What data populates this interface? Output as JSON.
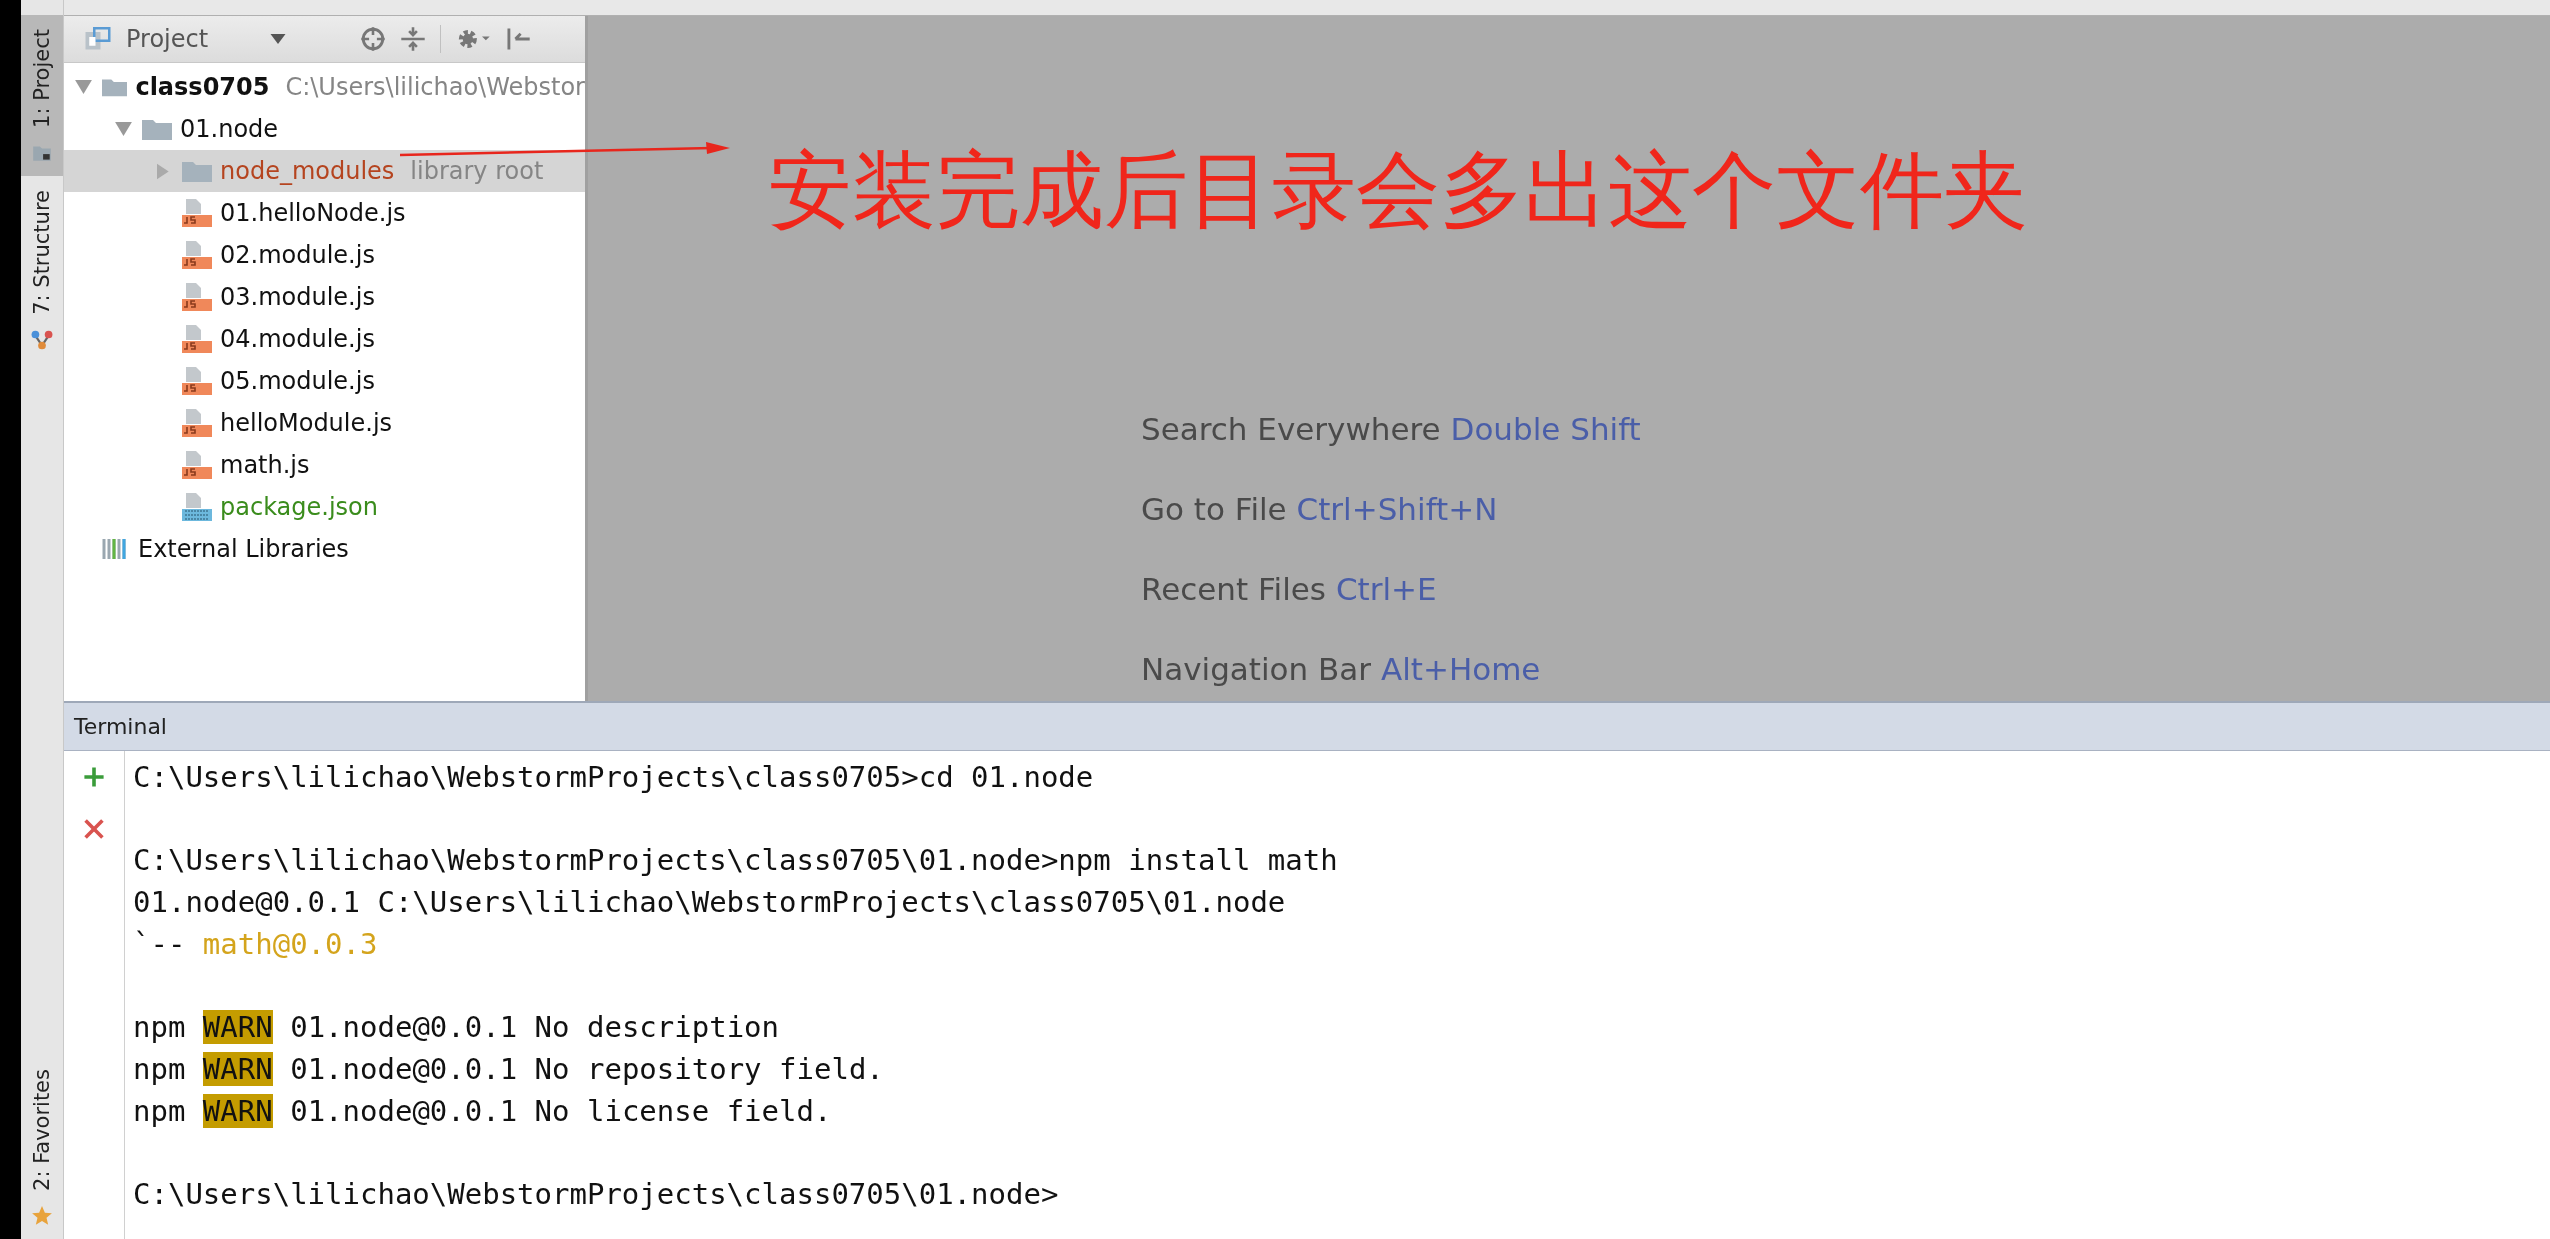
{
  "side_tabs_top": [
    {
      "label": "1: Project",
      "selected": true
    },
    {
      "label": "7: Structure",
      "selected": false
    }
  ],
  "side_tabs_bottom": [
    {
      "label": "2: Favorites",
      "selected": false
    }
  ],
  "project_panel": {
    "title": "Project",
    "tree": [
      {
        "name": "class0705",
        "path": "C:\\Users\\lilichao\\Webstor",
        "kind": "module",
        "expanded": true,
        "selected": false,
        "children": [
          {
            "name": "01.node",
            "kind": "folder",
            "expanded": true,
            "selected": false,
            "children": [
              {
                "name": "node_modules",
                "note": "library root",
                "kind": "library_folder",
                "expanded": false,
                "selected": true
              },
              {
                "name": "01.helloNode.js",
                "kind": "js",
                "selected": false
              },
              {
                "name": "02.module.js",
                "kind": "js",
                "selected": false
              },
              {
                "name": "03.module.js",
                "kind": "js",
                "selected": false
              },
              {
                "name": "04.module.js",
                "kind": "js",
                "selected": false
              },
              {
                "name": "05.module.js",
                "kind": "js",
                "selected": false
              },
              {
                "name": "helloModule.js",
                "kind": "js",
                "selected": false
              },
              {
                "name": "math.js",
                "kind": "js",
                "selected": false
              },
              {
                "name": "package.json",
                "kind": "json",
                "selected": false
              }
            ]
          }
        ]
      },
      {
        "name": "External Libraries",
        "kind": "libraries",
        "selected": false
      }
    ]
  },
  "editor": {
    "annotation": "安装完成后目录会多出这个文件夹",
    "hints": [
      {
        "action": "Search Everywhere",
        "shortcut": "Double Shift"
      },
      {
        "action": "Go to File",
        "shortcut": "Ctrl+Shift+N"
      },
      {
        "action": "Recent Files",
        "shortcut": "Ctrl+E"
      },
      {
        "action": "Navigation Bar",
        "shortcut": "Alt+Home"
      }
    ]
  },
  "terminal": {
    "title": "Terminal",
    "lines": [
      {
        "kind": "plain",
        "text": "C:\\Users\\lilichao\\WebstormProjects\\class0705>cd 01.node"
      },
      {
        "kind": "blank"
      },
      {
        "kind": "plain",
        "text": "C:\\Users\\lilichao\\WebstormProjects\\class0705\\01.node>npm install math"
      },
      {
        "kind": "plain",
        "text": "01.node@0.0.1 C:\\Users\\lilichao\\WebstormProjects\\class0705\\01.node"
      },
      {
        "kind": "tree",
        "branch": "`--",
        "text": "math@0.0.3"
      },
      {
        "kind": "blank"
      },
      {
        "kind": "warn",
        "prefix": "npm",
        "tag": "WARN",
        "text": "01.node@0.0.1 No description"
      },
      {
        "kind": "warn",
        "prefix": "npm",
        "tag": "WARN",
        "text": "01.node@0.0.1 No repository field."
      },
      {
        "kind": "warn",
        "prefix": "npm",
        "tag": "WARN",
        "text": "01.node@0.0.1 No license field."
      },
      {
        "kind": "blank"
      },
      {
        "kind": "plain",
        "text": "C:\\Users\\lilichao\\WebstormProjects\\class0705\\01.node>"
      }
    ]
  }
}
